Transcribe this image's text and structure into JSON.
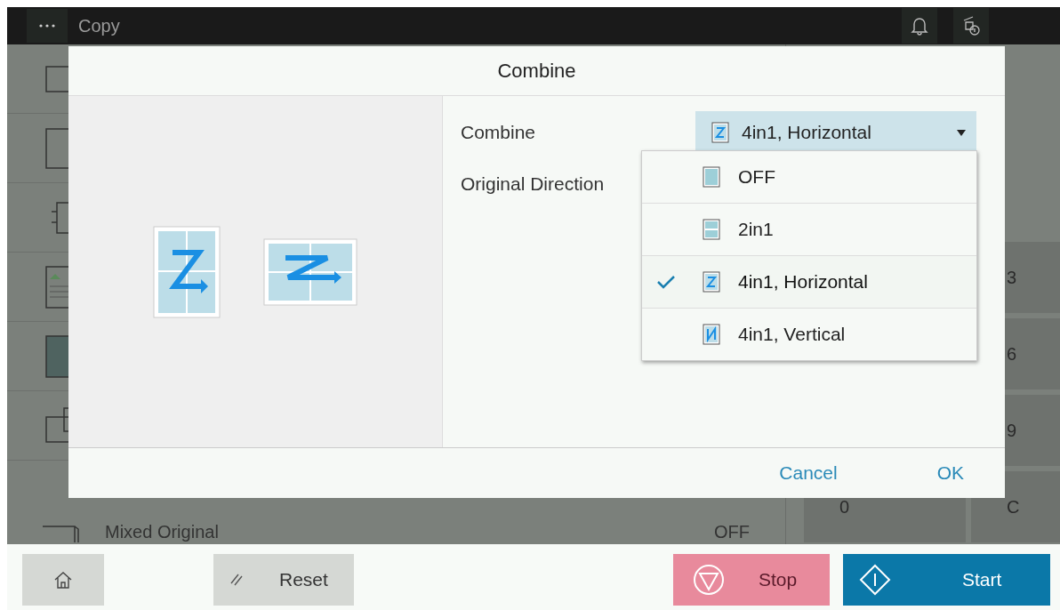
{
  "top_bar": {
    "title": "Copy"
  },
  "background_list": {
    "last_item": {
      "label": "Mixed Original",
      "value": "OFF"
    }
  },
  "keypad": {
    "keys": [
      "3",
      "6",
      "9",
      "0",
      "C"
    ]
  },
  "dialog": {
    "title": "Combine",
    "fields": [
      {
        "label": "Combine",
        "value": "4in1, Horizontal"
      },
      {
        "label": "Original Direction"
      }
    ],
    "options": [
      {
        "kind": "off",
        "label": "OFF",
        "selected": false
      },
      {
        "kind": "twoup",
        "label": "2in1",
        "selected": false
      },
      {
        "kind": "horizontal",
        "label": "4in1, Horizontal",
        "selected": true
      },
      {
        "kind": "vertical",
        "label": "4in1, Vertical",
        "selected": false
      }
    ],
    "buttons": [
      "Cancel",
      "OK"
    ]
  },
  "bottom_bar": {
    "reset": "Reset",
    "stop": "Stop",
    "start": "Start"
  }
}
